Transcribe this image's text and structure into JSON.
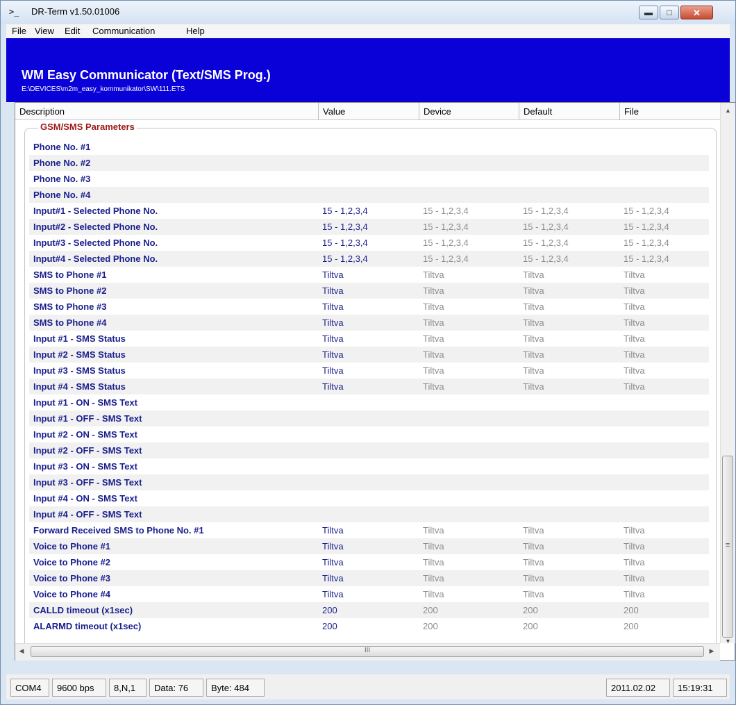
{
  "window": {
    "title": "DR-Term  v1.50.01006",
    "title_icon": "terminal-icon"
  },
  "menu": [
    "File",
    "View",
    "Edit",
    "Communication",
    "Help"
  ],
  "header": {
    "title": "WM Easy Communicator (Text/SMS Prog.)",
    "path": "E:\\DEVICES\\m2m_easy_kommunikator\\SW\\111.ETS",
    "bg_color": "#0a00d8"
  },
  "columns": {
    "description": "Description",
    "value": "Value",
    "device": "Device",
    "default": "Default",
    "file": "File"
  },
  "group_title": "GSM/SMS Parameters",
  "rows": [
    {
      "desc": "Phone No. #1",
      "value": "",
      "device": "",
      "default": "",
      "file": ""
    },
    {
      "desc": "Phone No. #2",
      "value": "",
      "device": "",
      "default": "",
      "file": ""
    },
    {
      "desc": "Phone No. #3",
      "value": "",
      "device": "",
      "default": "",
      "file": ""
    },
    {
      "desc": "Phone No. #4",
      "value": "",
      "device": "",
      "default": "",
      "file": ""
    },
    {
      "desc": "Input#1 - Selected Phone No.",
      "value": "15 - 1,2,3,4",
      "device": "15 - 1,2,3,4",
      "default": "15 - 1,2,3,4",
      "file": "15 - 1,2,3,4"
    },
    {
      "desc": "Input#2 - Selected Phone No.",
      "value": "15 - 1,2,3,4",
      "device": "15 - 1,2,3,4",
      "default": "15 - 1,2,3,4",
      "file": "15 - 1,2,3,4"
    },
    {
      "desc": "Input#3 - Selected Phone No.",
      "value": "15 - 1,2,3,4",
      "device": "15 - 1,2,3,4",
      "default": "15 - 1,2,3,4",
      "file": "15 - 1,2,3,4"
    },
    {
      "desc": "Input#4 - Selected Phone No.",
      "value": "15 - 1,2,3,4",
      "device": "15 - 1,2,3,4",
      "default": "15 - 1,2,3,4",
      "file": "15 - 1,2,3,4"
    },
    {
      "desc": "SMS to Phone #1",
      "value": "Tiltva",
      "device": "Tiltva",
      "default": "Tiltva",
      "file": "Tiltva"
    },
    {
      "desc": "SMS to Phone #2",
      "value": "Tiltva",
      "device": "Tiltva",
      "default": "Tiltva",
      "file": "Tiltva"
    },
    {
      "desc": "SMS to Phone #3",
      "value": "Tiltva",
      "device": "Tiltva",
      "default": "Tiltva",
      "file": "Tiltva"
    },
    {
      "desc": "SMS to Phone #4",
      "value": "Tiltva",
      "device": "Tiltva",
      "default": "Tiltva",
      "file": "Tiltva"
    },
    {
      "desc": "Input #1 - SMS Status",
      "value": "Tiltva",
      "device": "Tiltva",
      "default": "Tiltva",
      "file": "Tiltva"
    },
    {
      "desc": "Input #2 - SMS Status",
      "value": "Tiltva",
      "device": "Tiltva",
      "default": "Tiltva",
      "file": "Tiltva"
    },
    {
      "desc": "Input #3 - SMS Status",
      "value": "Tiltva",
      "device": "Tiltva",
      "default": "Tiltva",
      "file": "Tiltva"
    },
    {
      "desc": "Input #4 - SMS Status",
      "value": "Tiltva",
      "device": "Tiltva",
      "default": "Tiltva",
      "file": "Tiltva"
    },
    {
      "desc": "Input #1 - ON - SMS Text",
      "value": "",
      "device": "",
      "default": "",
      "file": ""
    },
    {
      "desc": "Input #1 - OFF - SMS Text",
      "value": "",
      "device": "",
      "default": "",
      "file": ""
    },
    {
      "desc": "Input #2 - ON - SMS Text",
      "value": "",
      "device": "",
      "default": "",
      "file": ""
    },
    {
      "desc": "Input #2 - OFF - SMS Text",
      "value": "",
      "device": "",
      "default": "",
      "file": ""
    },
    {
      "desc": "Input #3 - ON - SMS Text",
      "value": "",
      "device": "",
      "default": "",
      "file": ""
    },
    {
      "desc": "Input #3 - OFF - SMS Text",
      "value": "",
      "device": "",
      "default": "",
      "file": ""
    },
    {
      "desc": "Input #4 - ON - SMS Text",
      "value": "",
      "device": "",
      "default": "",
      "file": ""
    },
    {
      "desc": "Input #4 - OFF - SMS Text",
      "value": "",
      "device": "",
      "default": "",
      "file": ""
    },
    {
      "desc": "Forward Received SMS to Phone No. #1",
      "value": "Tiltva",
      "device": "Tiltva",
      "default": "Tiltva",
      "file": "Tiltva"
    },
    {
      "desc": "Voice to Phone #1",
      "value": "Tiltva",
      "device": "Tiltva",
      "default": "Tiltva",
      "file": "Tiltva"
    },
    {
      "desc": "Voice to Phone #2",
      "value": "Tiltva",
      "device": "Tiltva",
      "default": "Tiltva",
      "file": "Tiltva"
    },
    {
      "desc": "Voice to Phone #3",
      "value": "Tiltva",
      "device": "Tiltva",
      "default": "Tiltva",
      "file": "Tiltva"
    },
    {
      "desc": "Voice to Phone #4",
      "value": "Tiltva",
      "device": "Tiltva",
      "default": "Tiltva",
      "file": "Tiltva"
    },
    {
      "desc": "CALLD timeout (x1sec)",
      "value": "200",
      "device": "200",
      "default": "200",
      "file": "200"
    },
    {
      "desc": "ALARMD timeout (x1sec)",
      "value": "200",
      "device": "200",
      "default": "200",
      "file": "200"
    }
  ],
  "status": {
    "port": "COM4",
    "baud": "9600 bps",
    "format": "8,N,1",
    "data": "Data: 76",
    "bytes": "Byte: 484",
    "date": "2011.02.02",
    "time": "15:19:31"
  },
  "colors": {
    "desc_text": "#1a1e8c",
    "group_title": "#9b1a1a",
    "inactive_text": "#8c8c8c"
  }
}
